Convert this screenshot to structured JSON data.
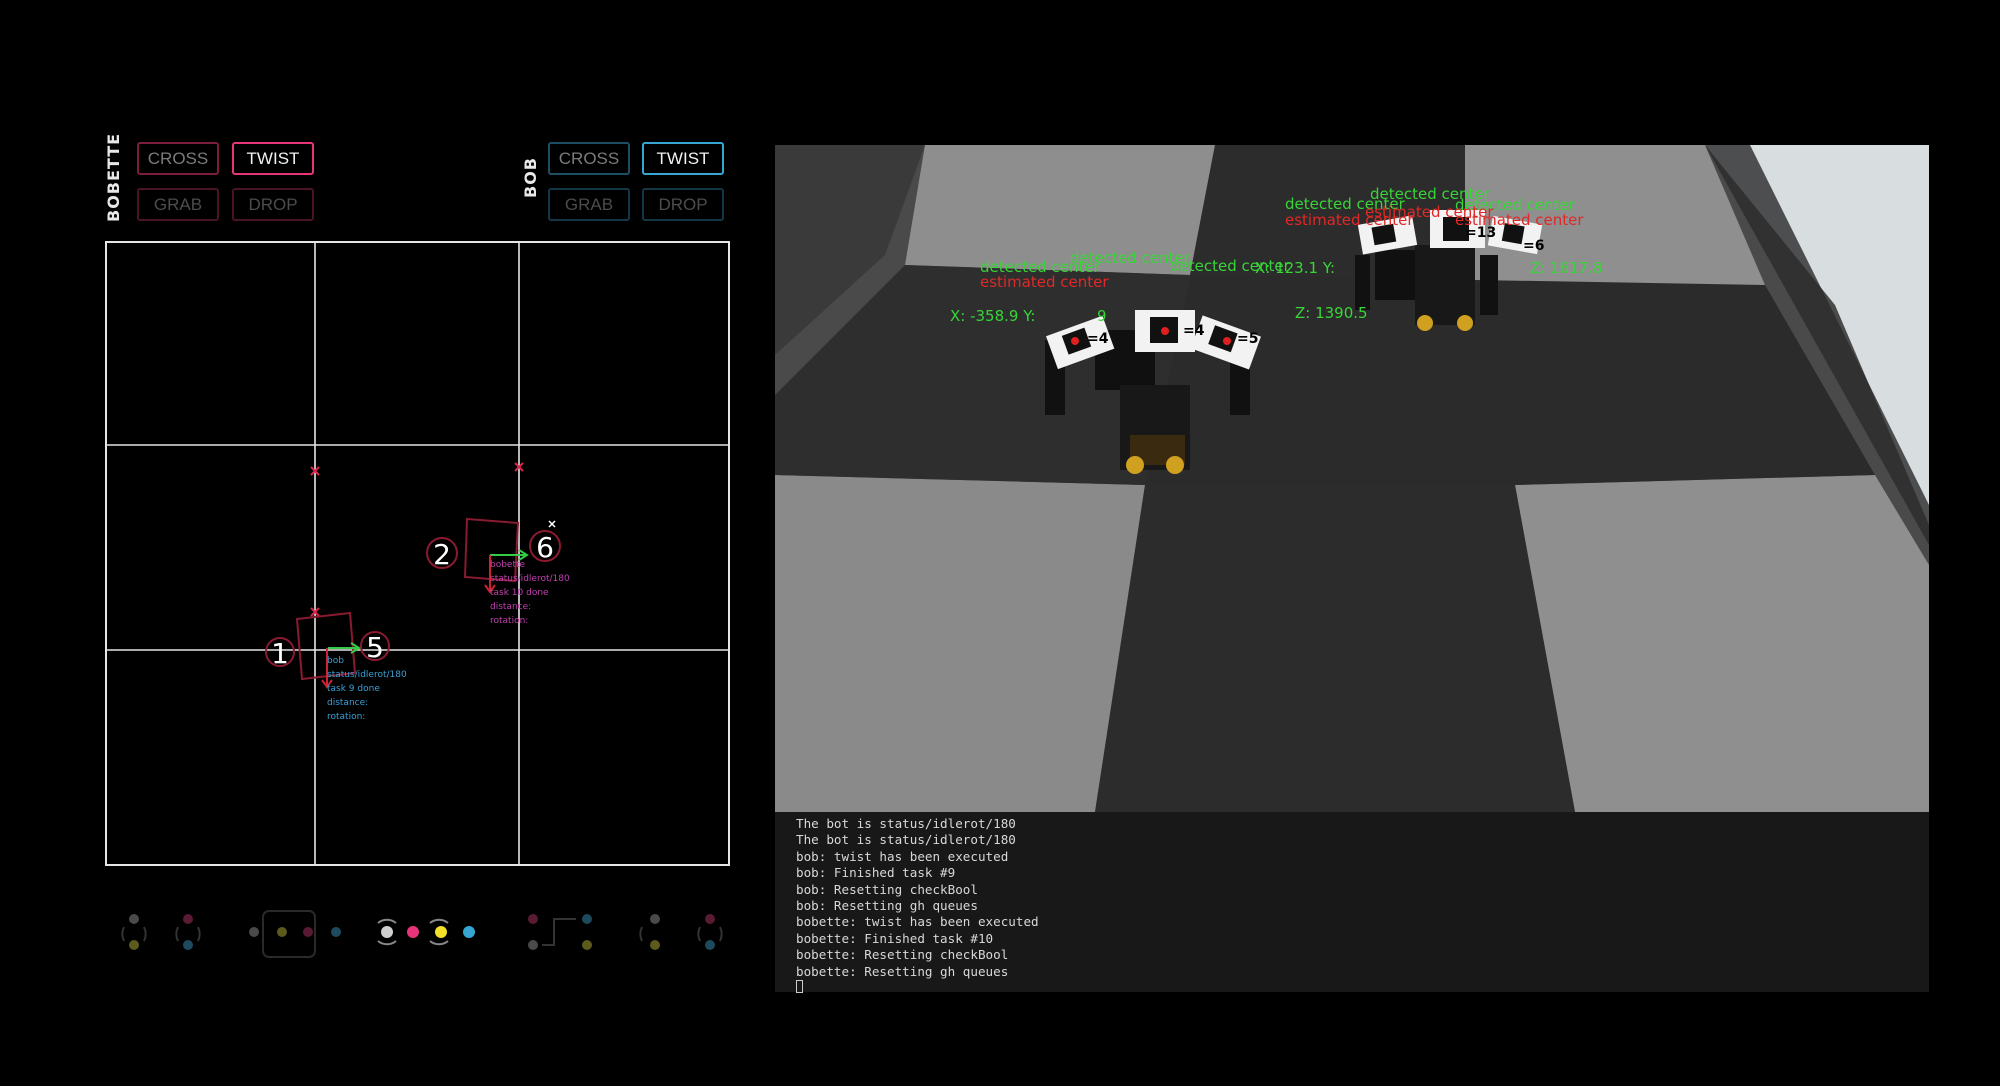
{
  "panels": {
    "bobette": {
      "name": "BOBETTE",
      "buttons": [
        "CROSS",
        "TWIST",
        "GRAB",
        "DROP"
      ],
      "accent": "#e8357a"
    },
    "bob": {
      "name": "BOB",
      "buttons": [
        "CROSS",
        "TWIST",
        "GRAB",
        "DROP"
      ],
      "accent": "#36a6d2"
    }
  },
  "map": {
    "markers": [
      "1",
      "5",
      "2",
      "6"
    ],
    "bob_info": [
      "bob",
      "status/idlerot/180",
      "task 9 done",
      "distance:",
      "rotation:"
    ],
    "bobette_info": [
      "bobette",
      "status/idlerot/180",
      "task 10 done",
      "distance:",
      "rotation:"
    ]
  },
  "bottom_controls": {
    "active_colors": [
      "#cfcfcf",
      "#e8357a",
      "#f2e12a",
      "#36a6d2"
    ],
    "dim_colors": [
      "#555555",
      "#6b1d38",
      "#6a6a20",
      "#1d4a5c"
    ]
  },
  "camera": {
    "overlay": {
      "detected": "detected center",
      "estimated": "estimated center",
      "coord_left": "X: -358.9 Y:",
      "coord_left_mid": "9",
      "coord_left_z": "Z: 1390.5",
      "coord_right": "X: 123.1 Y:",
      "coord_right_z": "Z: 1617.8",
      "id_4": "=4",
      "id_5": "=5",
      "id_13": "=13",
      "id_6": "=6"
    }
  },
  "terminal": {
    "lines": [
      "The bot is status/idlerot/180",
      "The bot is status/idlerot/180",
      "bob: twist has been executed",
      "bob: Finished task #9",
      "bob: Resetting checkBool",
      "bob: Resetting gh queues",
      "bobette: twist has been executed",
      "bobette: Finished task #10",
      "bobette: Resetting checkBool",
      "bobette: Resetting gh queues"
    ]
  }
}
